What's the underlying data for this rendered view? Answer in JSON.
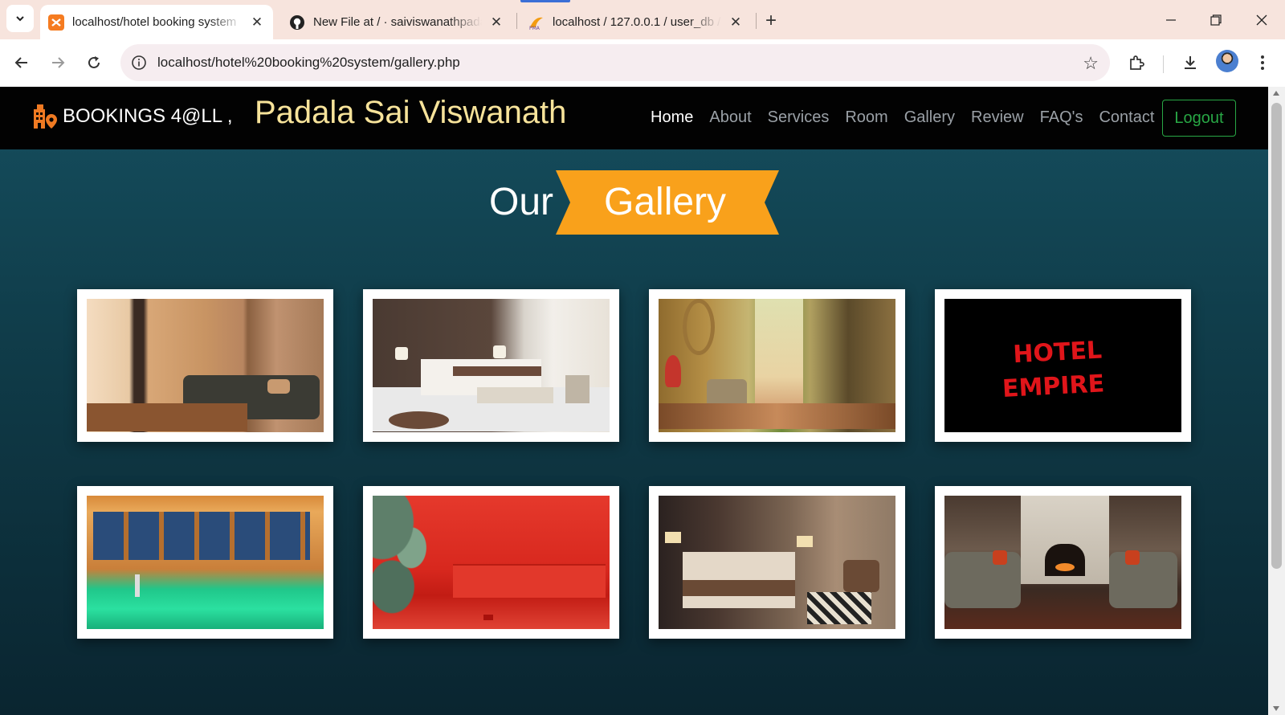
{
  "browser": {
    "tabs": [
      {
        "title": "localhost/hotel booking system",
        "icon": "xampp-icon",
        "active": true
      },
      {
        "title": "New File at / · saiviswanathpadala",
        "icon": "github-icon",
        "active": false
      },
      {
        "title": "localhost / 127.0.0.1 / user_db / ",
        "icon": "phpmyadmin-icon",
        "active": false
      }
    ],
    "url": "localhost/hotel%20booking%20system/gallery.php"
  },
  "site": {
    "brand": "BOOKINGS 4@LL ,",
    "owner_name": "Padala Sai Viswanath",
    "nav": [
      {
        "label": "Home",
        "current": true
      },
      {
        "label": "About"
      },
      {
        "label": "Services"
      },
      {
        "label": "Room"
      },
      {
        "label": "Gallery"
      },
      {
        "label": "Review"
      },
      {
        "label": "FAQ's"
      },
      {
        "label": "Contact"
      }
    ],
    "logout_label": "Logout"
  },
  "gallery": {
    "heading_prefix": "Our",
    "heading_highlight": "Gallery",
    "accent_color": "#f9a11b",
    "images": [
      {
        "subject": "living-room"
      },
      {
        "subject": "bedroom-white"
      },
      {
        "subject": "lobby-corridor"
      },
      {
        "subject": "hotel-empire-sign",
        "text": "HOTEL EMPIRE"
      },
      {
        "subject": "indoor-pool"
      },
      {
        "subject": "red-lounge"
      },
      {
        "subject": "bedroom-suite"
      },
      {
        "subject": "fireplace-lounge"
      }
    ]
  }
}
